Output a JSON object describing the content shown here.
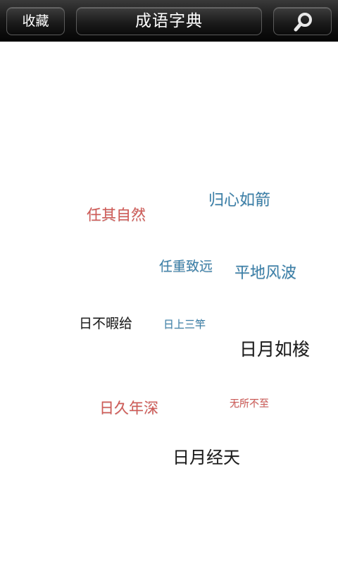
{
  "header": {
    "favorites_label": "收藏",
    "title": "成语字典",
    "search_icon": "search-icon"
  },
  "idioms": [
    {
      "text": "归心如箭",
      "color": "#3a7fa8"
    },
    {
      "text": "任其自然",
      "color": "#cf5a56"
    },
    {
      "text": "任重致远",
      "color": "#3a7fa8"
    },
    {
      "text": "平地风波",
      "color": "#3a7fa8"
    },
    {
      "text": "日不暇给",
      "color": "#1a1a1a"
    },
    {
      "text": "日上三竿",
      "color": "#3a7fa8"
    },
    {
      "text": "日月如梭",
      "color": "#1a1a1a"
    },
    {
      "text": "日久年深",
      "color": "#cf5a56"
    },
    {
      "text": "无所不至",
      "color": "#cf5a56"
    },
    {
      "text": "日月经天",
      "color": "#1a1a1a"
    }
  ]
}
